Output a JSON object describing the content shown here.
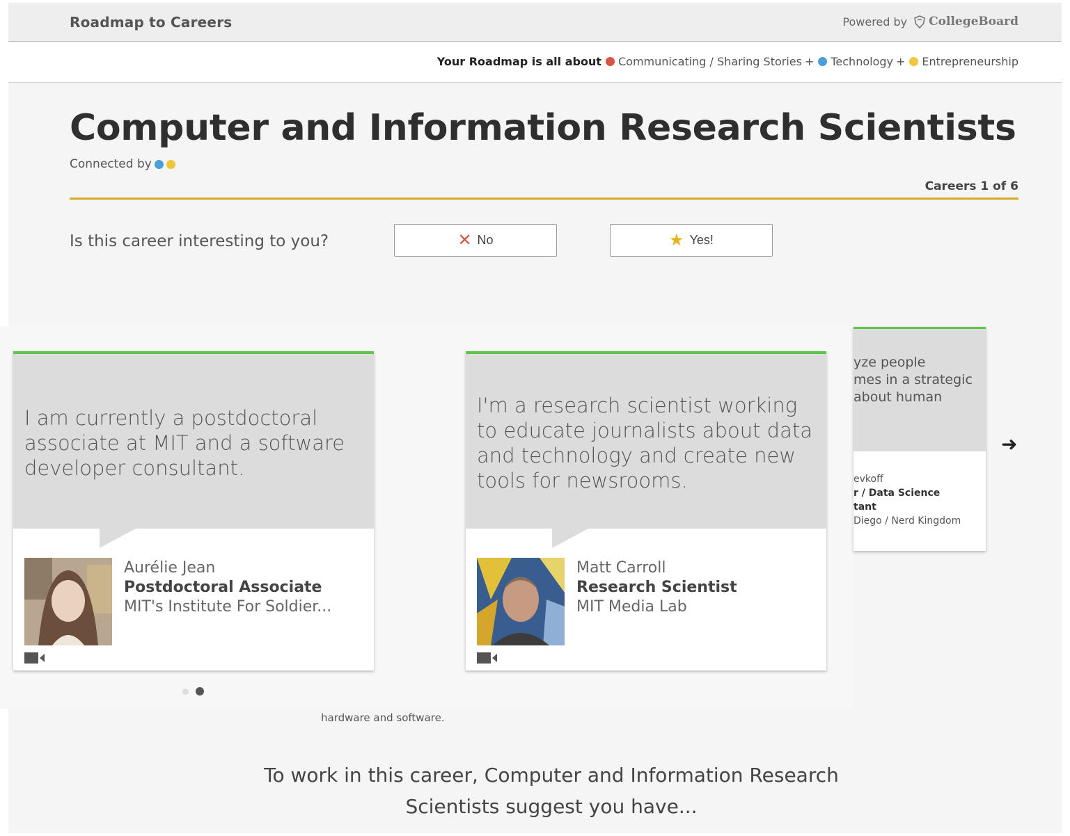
{
  "header": {
    "brand": "Roadmap to Careers",
    "powered_label": "Powered by",
    "logo_text": "CollegeBoard"
  },
  "roadmap": {
    "lead": "Your Roadmap is all about",
    "interests": [
      {
        "label": "Communicating / Sharing Stories",
        "color": "#d9543f"
      },
      {
        "label": "Technology",
        "color": "#4a9fd8"
      },
      {
        "label": "Entrepreneurship",
        "color": "#f2c53d"
      }
    ],
    "separator": "+"
  },
  "career": {
    "title": "Computer and Information Research Scientists",
    "connected_label": "Connected by",
    "connected_colors": [
      "#4a9fd8",
      "#f2c53d"
    ],
    "count_label": "Careers 1 of 6"
  },
  "question": {
    "prompt": "Is this career interesting to you?",
    "no_label": "No",
    "yes_label": "Yes!"
  },
  "carousel": {
    "cards": [
      {
        "quote": "I am currently a postdoctoral associate at MIT and a software developer consultant.",
        "name": "Aurélie Jean",
        "role": "Postdoctoral Associate",
        "org": "MIT's Institute For Soldier..."
      },
      {
        "quote": "I'm a research scientist working to educate journalists about data and technology and create new tools for newsrooms.",
        "name": "Matt Carroll",
        "role": "Research Scientist",
        "org": "MIT Media Lab"
      }
    ],
    "partial_card": {
      "quote_lines": [
        "yze people",
        "mes in a strategic",
        "about human"
      ],
      "name": "evkoff",
      "role_line1": "r / Data Science",
      "role_line2": "tant",
      "org": "Diego / Nerd Kingdom"
    },
    "pager": {
      "total": 2,
      "active": 2
    }
  },
  "description_tail": "hardware and software.",
  "suggest_text": "To work in this career, Computer and Information Research Scientists suggest you have..."
}
